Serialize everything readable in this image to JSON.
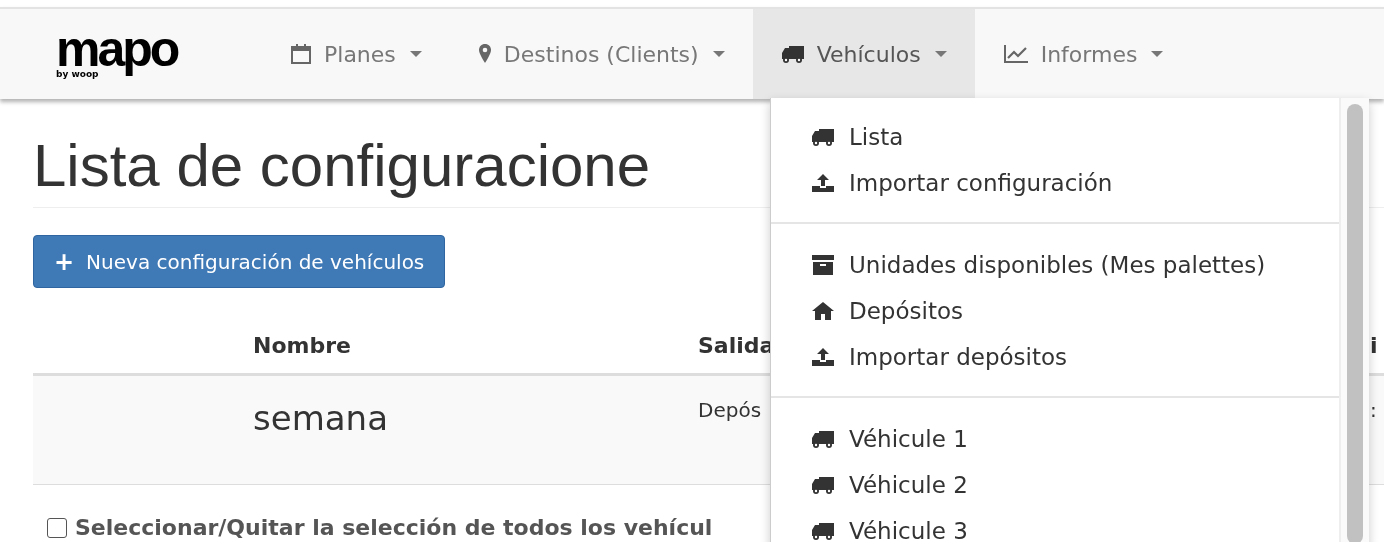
{
  "navbar": {
    "logo": {
      "wordmark": "mapo",
      "tagline": "by woop"
    },
    "menus": [
      {
        "label": "Planes",
        "kind": "calendar",
        "selected": false
      },
      {
        "label": "Destinos (Clients)",
        "kind": "marker",
        "selected": false
      },
      {
        "label": "Vehículos",
        "kind": "truck",
        "selected": true
      },
      {
        "label": "Informes",
        "kind": "chart",
        "selected": false
      }
    ]
  },
  "page": {
    "title": "Lista de configuracione",
    "new_button": {
      "icon": "+",
      "label": "Nueva configuración de vehículos"
    },
    "table": {
      "columns": [
        "Nombre",
        "Salida",
        "i"
      ],
      "rows": [
        {
          "cells": [
            "semana",
            "Depós",
            ":"
          ]
        }
      ]
    },
    "select_all": {
      "label": "Seleccionar/Quitar la selección de todos los vehícul",
      "checked": false
    }
  },
  "dropdown": {
    "groups": [
      [
        {
          "label": "Lista",
          "kind": "truck"
        },
        {
          "label": "Importar configuración",
          "kind": "upload"
        }
      ],
      [
        {
          "label": "Unidades disponibles (Mes palettes)",
          "kind": "archive"
        },
        {
          "label": "Depósitos",
          "kind": "home"
        },
        {
          "label": "Importar depósitos",
          "kind": "upload"
        }
      ],
      [
        {
          "label": "Véhicule 1",
          "kind": "truck"
        },
        {
          "label": "Véhicule 2",
          "kind": "truck"
        },
        {
          "label": "Véhicule 3",
          "kind": "truck"
        }
      ]
    ]
  }
}
